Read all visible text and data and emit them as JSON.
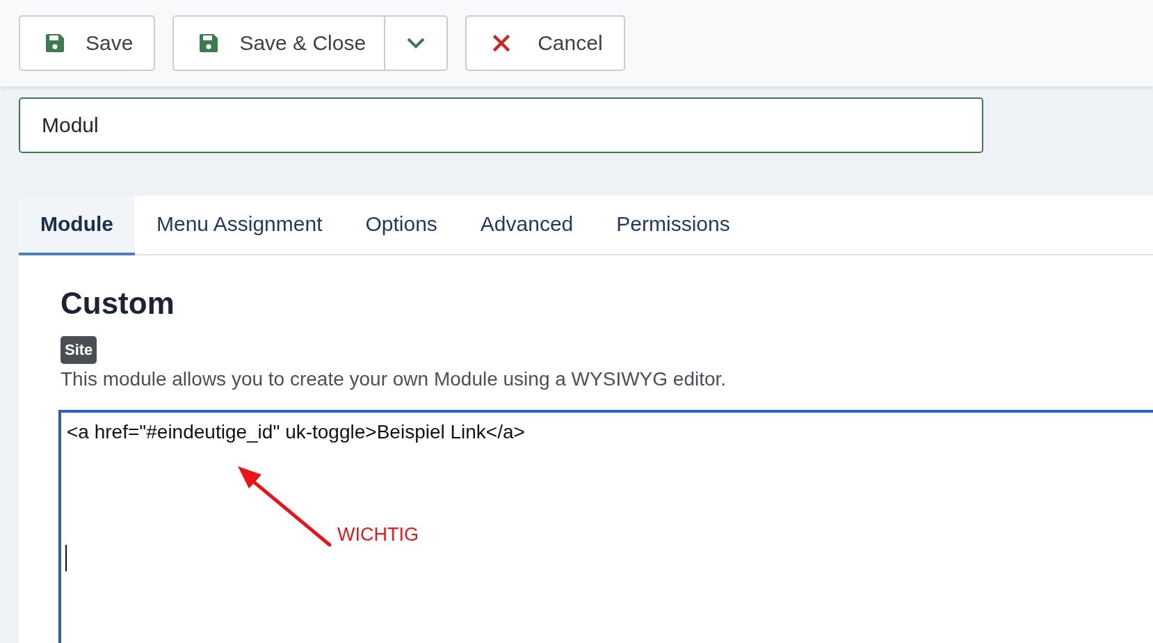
{
  "toolbar": {
    "buttons": [
      {
        "kind": "save",
        "label": "Save"
      },
      {
        "kind": "split",
        "label": "Save & Close"
      },
      {
        "kind": "cancel",
        "label": "Cancel"
      }
    ]
  },
  "title_field": {
    "value": "Modul"
  },
  "tabs": [
    {
      "label": "Module",
      "selected": true
    },
    {
      "label": "Menu Assignment",
      "selected": false
    },
    {
      "label": "Options",
      "selected": false
    },
    {
      "label": "Advanced",
      "selected": false
    },
    {
      "label": "Permissions",
      "selected": false
    }
  ],
  "module": {
    "heading": "Custom",
    "badge": "Site",
    "description": "This module allows you to create your own Module using a WYSIWYG editor.",
    "editor": {
      "content": "<a href=\"#eindeutige_id\" uk-toggle>Beispiel Link</a>",
      "focused": true
    }
  },
  "annotation": {
    "label": "WICHTIG"
  }
}
